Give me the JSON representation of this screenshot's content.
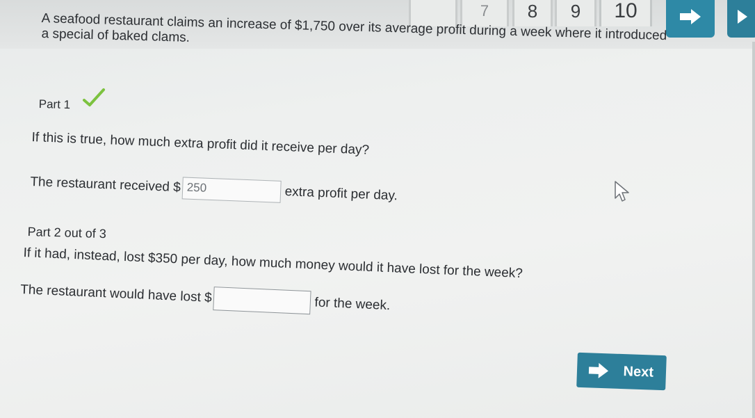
{
  "nav": {
    "questions": [
      {
        "label": "",
        "state": "partial"
      },
      {
        "label": "7",
        "state": "partial"
      },
      {
        "label": "8",
        "state": "normal"
      },
      {
        "label": "9",
        "state": "normal"
      },
      {
        "label": "10",
        "state": "current"
      }
    ],
    "next_icon": "arrow-right-icon",
    "last_icon": "play-icon",
    "accent": "#2d7f9a"
  },
  "problem": {
    "line1": "A seafood restaurant claims an increase of $1,750 over its average profit during a week where it introduced",
    "line2": "a special of baked clams."
  },
  "part1": {
    "label": "Part 1",
    "status_icon": "checkmark-icon",
    "status_color": "#7cc23f",
    "question": "If this is true, how much extra profit did it receive per day?",
    "answer_prefix": "The restaurant received $",
    "answer_value": "250",
    "answer_suffix": "extra profit per day."
  },
  "part2": {
    "label": "Part 2 out of 3",
    "question": "If it had, instead, lost $350 per day, how much money would it have lost for the week?",
    "answer_prefix": "The restaurant would have lost $",
    "answer_value": "",
    "answer_suffix": "for the week."
  },
  "next_button": {
    "label": "Next",
    "icon": "arrow-right-icon"
  }
}
